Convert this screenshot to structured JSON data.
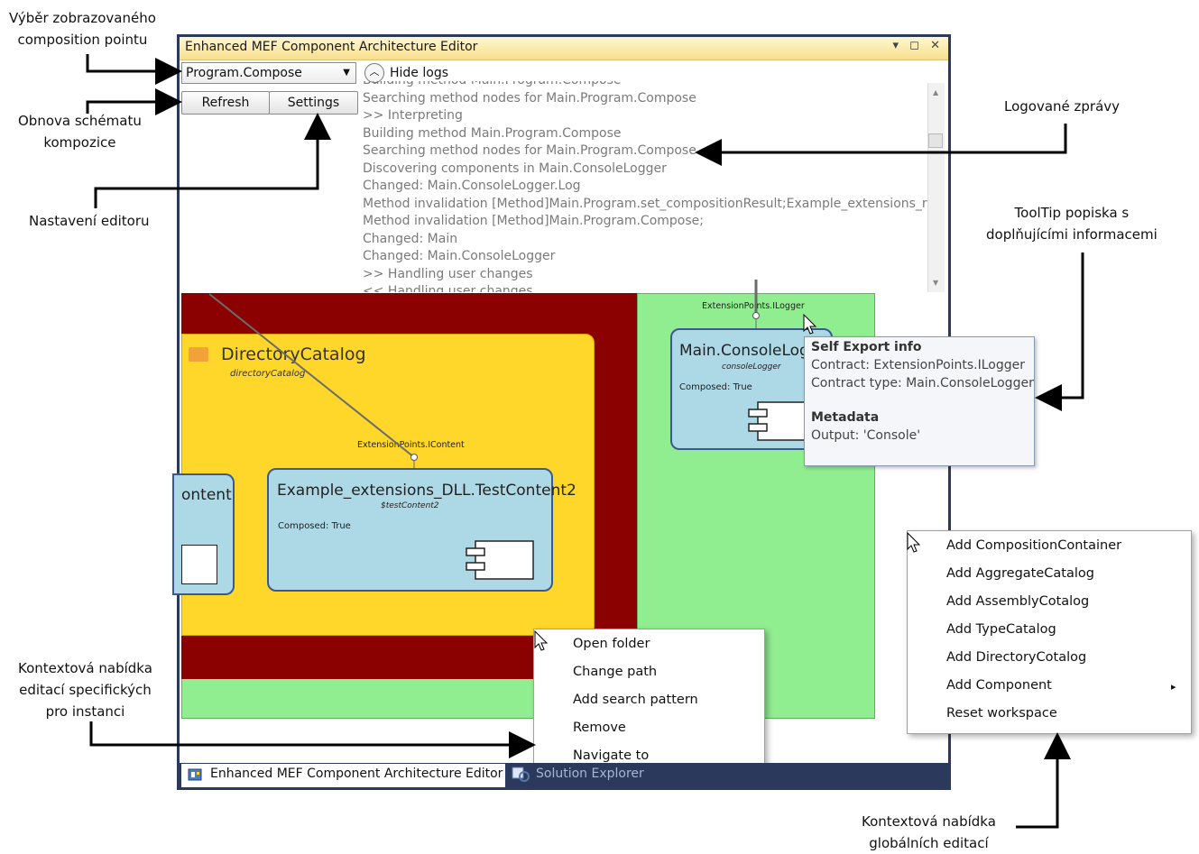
{
  "annotations": {
    "composition_point": [
      "Výběr zobrazovaného",
      "composition pointu"
    ],
    "refresh": [
      "Obnova schématu",
      "kompozice"
    ],
    "settings": "Nastavení editoru",
    "logs": "Logované zprávy",
    "tooltip": [
      "ToolTip popiska s",
      "doplňujícími informacemi"
    ],
    "instance_menu": [
      "Kontextová nabídka",
      "editací specifických",
      "pro instanci"
    ],
    "global_menu": [
      "Kontextová nabídka",
      "globálních editací"
    ]
  },
  "window": {
    "title": "Enhanced MEF Component Architecture Editor",
    "controls": "▾ ◻ ✕"
  },
  "toolbar": {
    "composition_point": "Program.Compose",
    "refresh_label": "Refresh",
    "settings_label": "Settings",
    "hide_logs_label": "Hide logs"
  },
  "log": [
    "Building method Main.Program.Compose",
    "Searching method nodes for Main.Program.Compose",
    ">> Interpreting",
    "Building method Main.Program.Compose",
    "Searching method nodes for Main.Program.Compose",
    "Discovering components in Main.ConsoleLogger",
    "Changed: Main.ConsoleLogger.Log",
    "Method invalidation [Method]Main.Program.set_compositionResult;Example_extensions_re",
    "Method invalidation [Method]Main.Program.Compose;",
    "Changed: Main",
    "Changed: Main.ConsoleLogger",
    ">> Handling user changes",
    "<< Handling user changes"
  ],
  "diagram": {
    "directory_catalog": {
      "title": "DirectoryCatalog",
      "sub": "directoryCatalog"
    },
    "content_partial": {
      "title": "ontent"
    },
    "test_content2": {
      "title": "Example_extensions_DLL.TestContent2",
      "sub": "$testContent2",
      "composed": "Composed: True",
      "port": "ExtensionPoints.IContent"
    },
    "console_logger": {
      "title": "Main.ConsoleLogg",
      "sub": "consoleLogger",
      "composed": "Composed: True",
      "port": "ExtensionPoints.ILogger"
    }
  },
  "tooltip": {
    "heading1": "Self Export info",
    "contract": "Contract: ExtensionPoints.ILogger",
    "contract_type": "Contract type: Main.ConsoleLogger",
    "heading2": "Metadata",
    "output": "Output: 'Console'"
  },
  "instance_menu": [
    "Open folder",
    "Change path",
    "Add search pattern",
    "Remove",
    "Navigate to"
  ],
  "global_menu": {
    "items": [
      "Add CompositionContainer",
      "Add AggregateCatalog",
      "Add AssemblyCotalog",
      "Add TypeCatalog",
      "Add DirectoryCotalog",
      "Add Component",
      "Reset workspace"
    ],
    "submenu_arrow": "▸"
  },
  "tabs": {
    "active": "Enhanced MEF Component Architecture Editor",
    "second": "Solution Explorer"
  },
  "colors": {
    "catalog_yellow": "#ffd62a",
    "aggregate_dark_red": "#8b0000",
    "container_green": "#90ee90",
    "component_blue": "#add8e6",
    "window_frame": "#2b3a5c"
  }
}
